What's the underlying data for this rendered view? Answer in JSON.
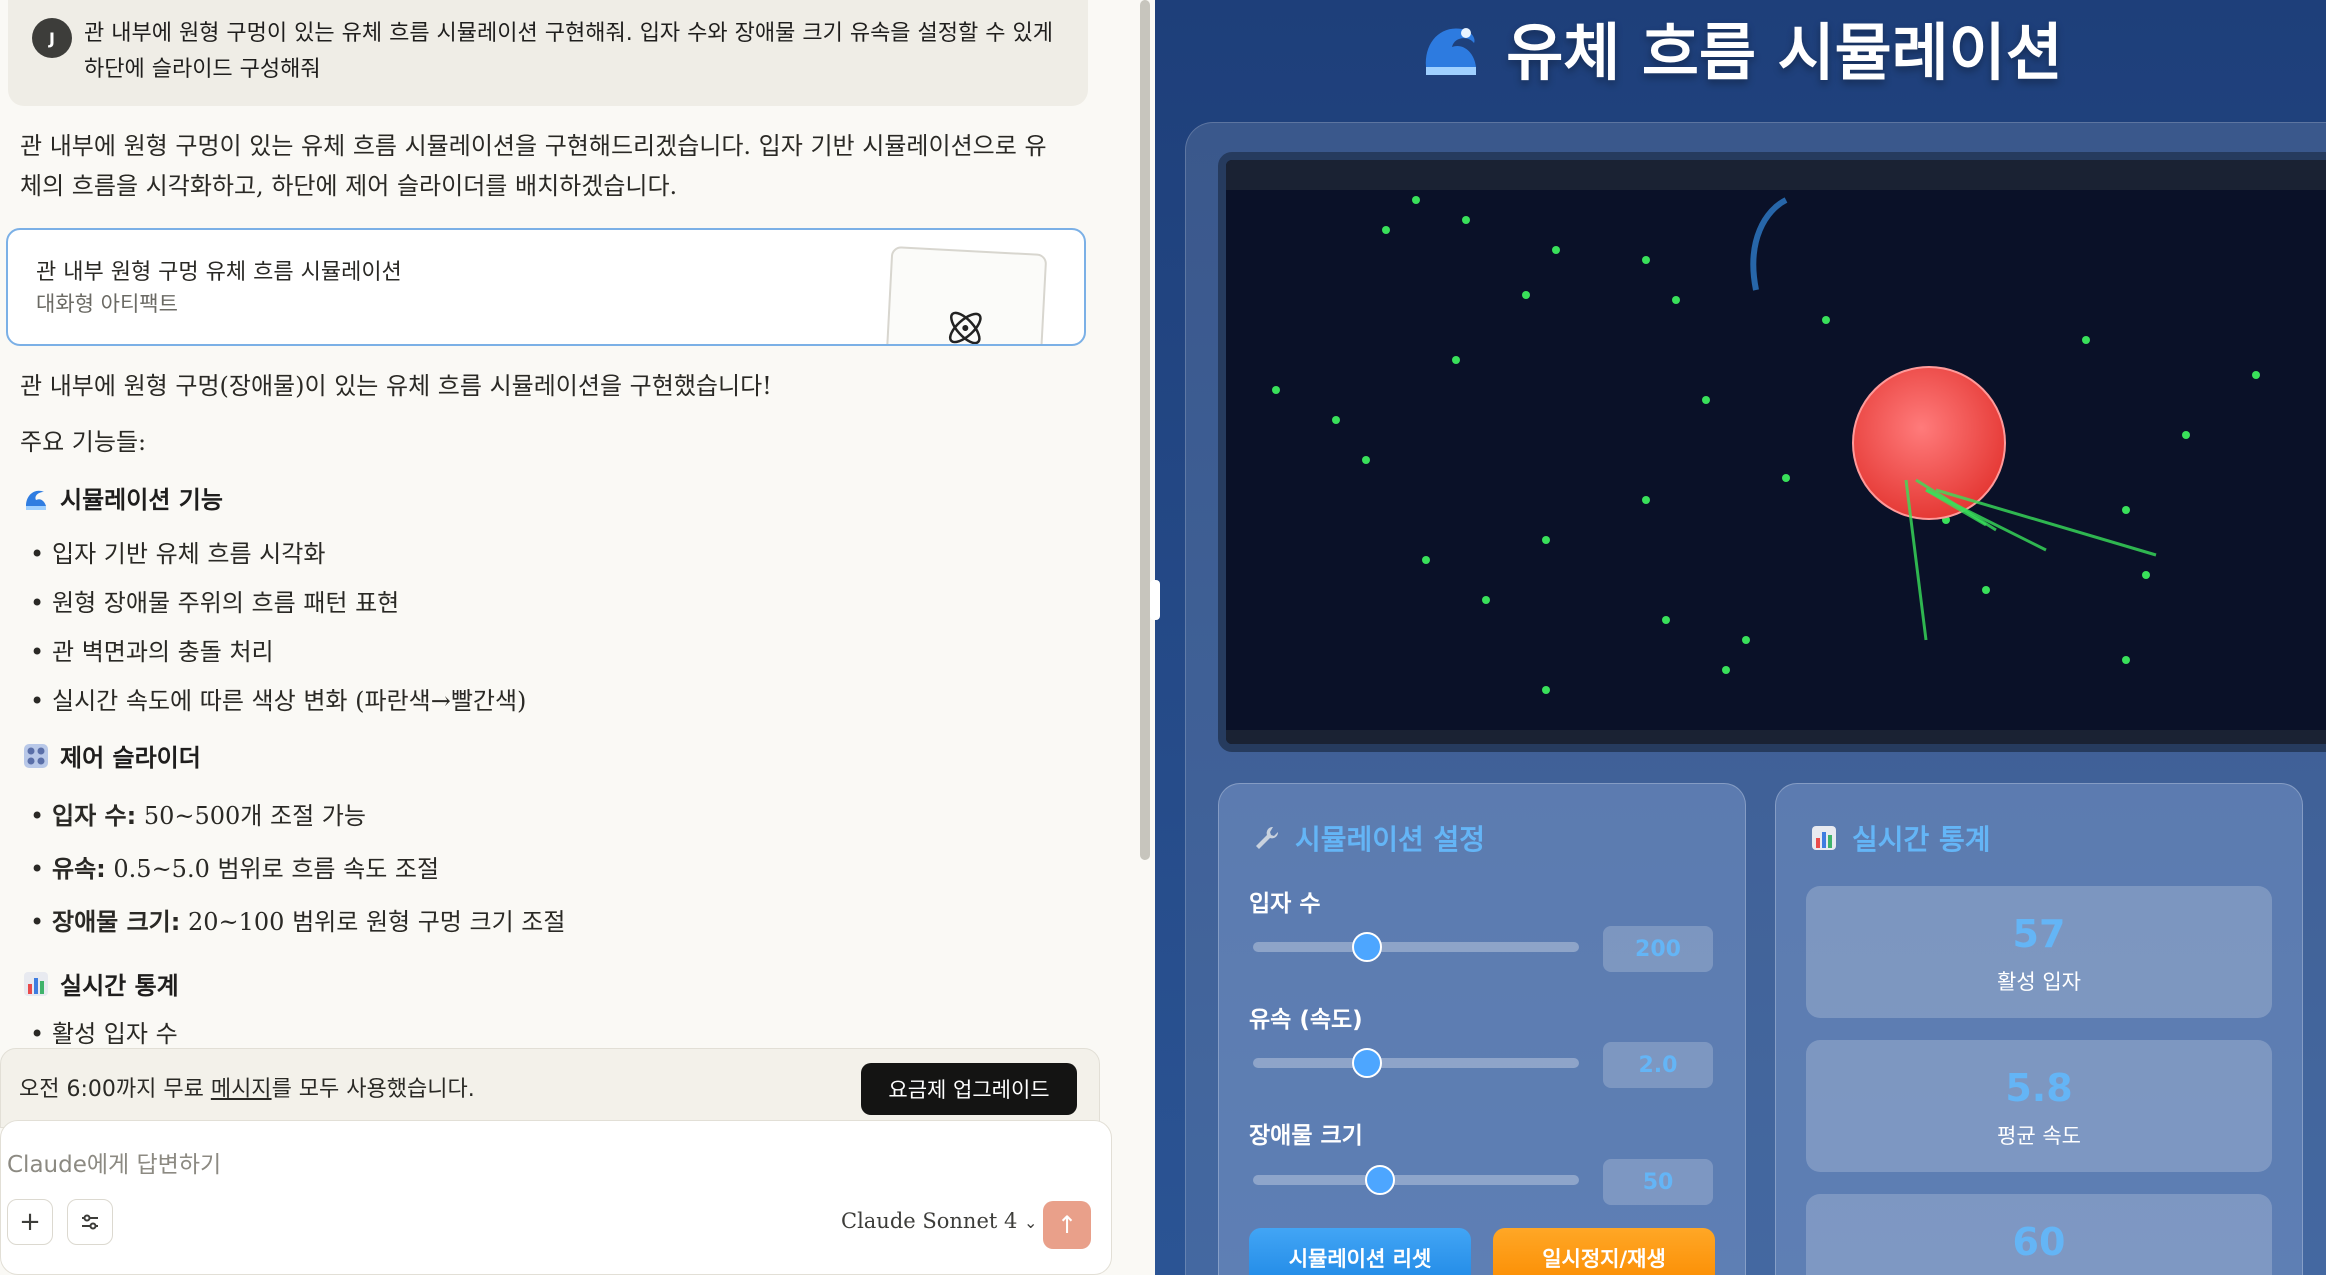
{
  "chat": {
    "user": {
      "avatar_initial": "J",
      "message": "관 내부에 원형 구멍이 있는 유체 흐름 시뮬레이션 구현해줘. 입자 수와 장애물 크기 유속을 설정할 수 있게 하단에 슬라이드 구성해줘"
    },
    "assistant_intro": "관 내부에 원형 구멍이 있는 유체 흐름 시뮬레이션을 구현해드리겠습니다. 입자 기반 시뮬레이션으로 유체의 흐름을 시각화하고, 하단에 제어 슬라이더를 배치하겠습니다.",
    "artifact": {
      "title": "관 내부 원형 구멍 유체 흐름 시뮬레이션",
      "subtitle": "대화형 아티팩트"
    },
    "summary": "관 내부에 원형 구멍(장애물)이 있는 유체 흐름 시뮬레이션을 구현했습니다!",
    "features_label": "주요 기능들:",
    "sections": [
      {
        "heading": "시뮬레이션 기능",
        "icon": "wave-icon",
        "items": [
          "입자 기반 유체 흐름 시각화",
          "원형 장애물 주위의 흐름 패턴 표현",
          "관 벽면과의 충돌 처리",
          "실시간 속도에 따른 색상 변화 (파란색→빨간색)"
        ]
      },
      {
        "heading": "제어 슬라이더",
        "icon": "control-knobs-icon",
        "items": [
          {
            "bold": "입자 수:",
            "text": " 50~500개 조절 가능"
          },
          {
            "bold": "유속:",
            "text": " 0.5~5.0 범위로 흐름 속도 조절"
          },
          {
            "bold": "장애물 크기:",
            "text": " 20~100 범위로 원형 구멍 크기 조절"
          }
        ]
      },
      {
        "heading": "실시간 통계",
        "icon": "bar-chart-icon",
        "items": [
          "활성 입자 수"
        ]
      }
    ],
    "limit_notice": {
      "prefix": "오전 6:00까지 무료 ",
      "link": "메시지",
      "suffix": "를 모두 사용했습니다."
    },
    "upgrade_label": "요금제 업그레이드",
    "composer": {
      "placeholder": "Claude에게 답변하기",
      "add_label": "+",
      "model": "Claude Sonnet 4"
    }
  },
  "app": {
    "title": "유체 흐름 시뮬레이션",
    "title_icon": "wave-icon",
    "settings": {
      "title": "시뮬레이션 설정",
      "icon": "wrench-icon",
      "sliders": [
        {
          "label": "입자 수",
          "value": "200",
          "fraction": 0.35
        },
        {
          "label": "유속 (속도)",
          "value": "2.0",
          "fraction": 0.35
        },
        {
          "label": "장애물 크기",
          "value": "50",
          "fraction": 0.39
        }
      ],
      "reset_label": "시뮬레이션 리셋",
      "pause_label": "일시정지/재생"
    },
    "stats": {
      "title": "실시간 통계",
      "icon": "bar-chart-icon",
      "items": [
        {
          "value": "57",
          "label": "활성 입자"
        },
        {
          "value": "5.8",
          "label": "평균 속도"
        },
        {
          "value": "60",
          "label": ""
        }
      ]
    },
    "colors": {
      "accent": "#64b5f6",
      "reset_button": "#2196f3",
      "pause_button": "#ff9800",
      "obstacle": "#ef5350",
      "particle": "#39e05a"
    }
  }
}
